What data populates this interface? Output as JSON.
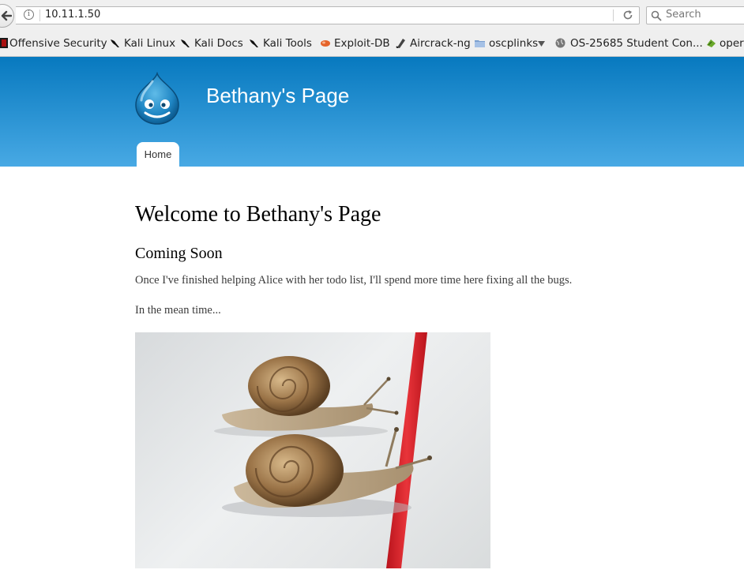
{
  "browser": {
    "url": "10.11.1.50",
    "search_placeholder": "Search",
    "bookmarks": [
      {
        "label": "Offensive Security",
        "icon": "offsec-icon"
      },
      {
        "label": "Kali Linux",
        "icon": "kali-icon"
      },
      {
        "label": "Kali Docs",
        "icon": "kali-icon"
      },
      {
        "label": "Kali Tools",
        "icon": "kali-icon"
      },
      {
        "label": "Exploit-DB",
        "icon": "exploitdb-icon"
      },
      {
        "label": "Aircrack-ng",
        "icon": "aircrack-icon"
      },
      {
        "label": "oscplinks",
        "icon": "folder-icon"
      },
      {
        "label": "OS-25685 Student Con...",
        "icon": "globe-icon"
      },
      {
        "label": "oper",
        "icon": "green-icon"
      }
    ]
  },
  "site": {
    "name": "Bethany's Page",
    "nav": {
      "home": "Home"
    }
  },
  "content": {
    "title": "Welcome to Bethany's Page",
    "subtitle": "Coming Soon",
    "paragraph1": "Once I've finished helping Alice with her todo list, I'll spend more time here fixing all the bugs.",
    "paragraph2": "In the mean time..."
  },
  "colors": {
    "header_top": "#0779bf",
    "header_bottom": "#48a9e4"
  }
}
